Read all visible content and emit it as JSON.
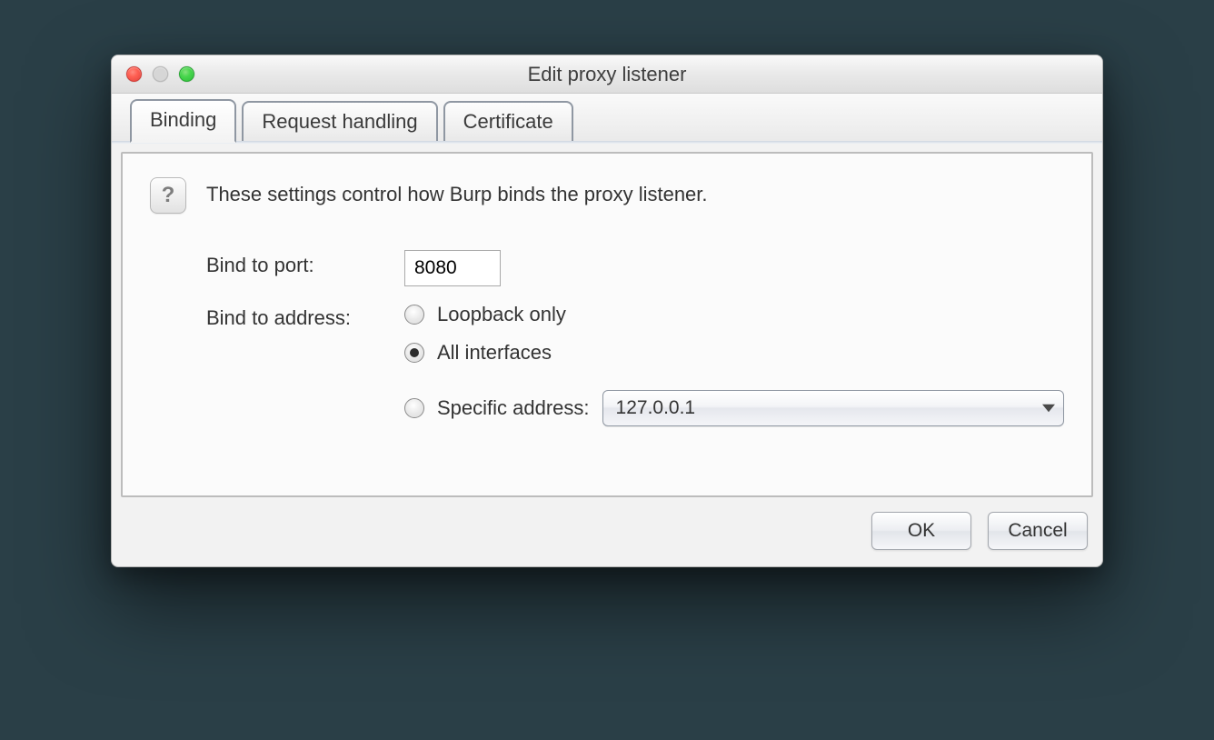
{
  "window": {
    "title": "Edit proxy listener"
  },
  "tabs": [
    {
      "label": "Binding",
      "active": true
    },
    {
      "label": "Request handling",
      "active": false
    },
    {
      "label": "Certificate",
      "active": false
    }
  ],
  "help": {
    "glyph": "?"
  },
  "intro": "These settings control how Burp binds the proxy listener.",
  "form": {
    "port_label": "Bind to port:",
    "port_value": "8080",
    "address_label": "Bind to address:",
    "options": {
      "loopback": "Loopback only",
      "all": "All interfaces",
      "specific": "Specific address:",
      "selected": "all",
      "specific_value": "127.0.0.1"
    }
  },
  "buttons": {
    "ok": "OK",
    "cancel": "Cancel"
  }
}
